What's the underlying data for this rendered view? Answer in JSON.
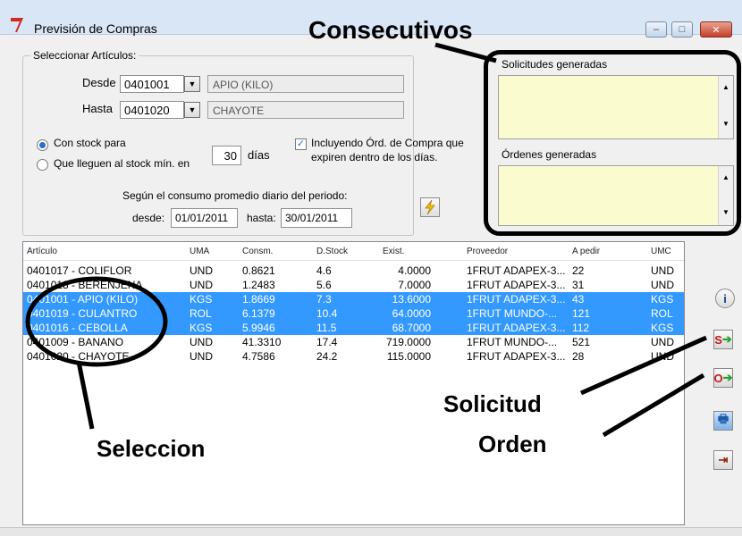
{
  "window": {
    "title": "Previsión de Compras",
    "minimize": "–",
    "maximize": "□",
    "close": "✕"
  },
  "annotations": {
    "consecutivos": "Consecutivos",
    "seleccion": "Seleccion",
    "solicitud": "Solicitud",
    "orden": "Orden"
  },
  "select_group": {
    "label": "Seleccionar Artículos:",
    "desde_label": "Desde",
    "desde_code": "0401001",
    "desde_name": "APIO (KILO)",
    "hasta_label": "Hasta",
    "hasta_code": "0401020",
    "hasta_name": "CHAYOTE",
    "radio_stock": "Con stock para",
    "radio_min": "Que lleguen al stock mín. en",
    "dias_value": "30",
    "dias_label": "días",
    "check_label_1": "Incluyendo Órd. de Compra que",
    "check_label_2": "expiren dentro de los días.",
    "consumo_label": "Según el consumo promedio diario del periodo:",
    "desde2_label": "desde:",
    "desde2_value": "01/01/2011",
    "hasta2_label": "hasta:",
    "hasta2_value": "30/01/2011"
  },
  "consecutivos": {
    "solicitudes_label": "Solicitudes generadas",
    "ordenes_label": "Órdenes generadas"
  },
  "list": {
    "headers": [
      "Artículo",
      "UMA",
      "Consm.",
      "D.Stock",
      "Exist.",
      "Proveedor",
      "A pedir",
      "UMC"
    ],
    "rows": [
      [
        "0401017 - COLIFLOR",
        "UND",
        "0.8621",
        "4.6",
        "4.0000",
        "1FRUT ADAPEX-3...",
        "22",
        "UND"
      ],
      [
        "0401018 - BERENJENA",
        "UND",
        "1.2483",
        "5.6",
        "7.0000",
        "1FRUT ADAPEX-3...",
        "31",
        "UND"
      ],
      [
        "0401001 - APIO (KILO)",
        "KGS",
        "1.8669",
        "7.3",
        "13.6000",
        "1FRUT ADAPEX-3...",
        "43",
        "KGS"
      ],
      [
        "0401019 - CULANTRO",
        "ROL",
        "6.1379",
        "10.4",
        "64.0000",
        "1FRUT MUNDO-...",
        "121",
        "ROL"
      ],
      [
        "0401016 - CEBOLLA",
        "KGS",
        "5.9946",
        "11.5",
        "68.7000",
        "1FRUT ADAPEX-3...",
        "112",
        "KGS"
      ],
      [
        "0401009 - BANANO",
        "UND",
        "41.3310",
        "17.4",
        "719.0000",
        "1FRUT MUNDO-...",
        "521",
        "UND"
      ],
      [
        "0401020 - CHAYOTE",
        "UND",
        "4.7586",
        "24.2",
        "115.0000",
        "1FRUT ADAPEX-3...",
        "28",
        "UND"
      ]
    ],
    "selected_rows": [
      2,
      3,
      4
    ]
  },
  "side_buttons": {
    "info": "i",
    "solicitud": "S",
    "orden": "O",
    "print": "🖶",
    "exit": "⇥"
  },
  "colors": {
    "selection": "#3399ff",
    "memo_bg": "#fbfbd0",
    "title_icon": "#d12a1f"
  }
}
